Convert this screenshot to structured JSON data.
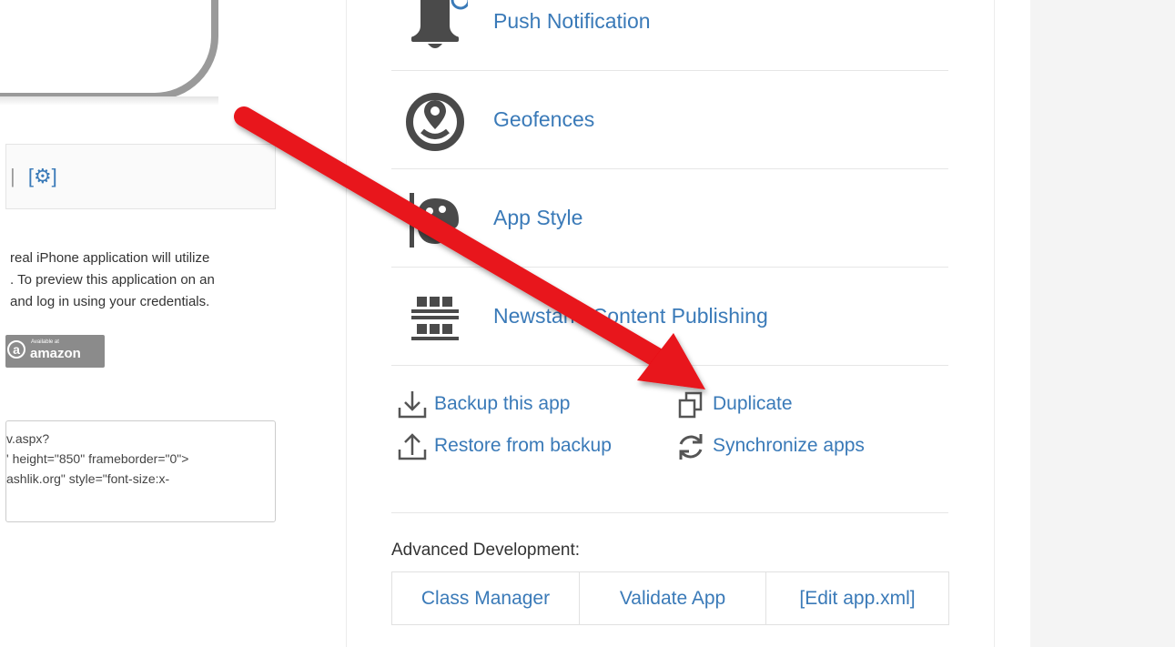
{
  "left_panel": {
    "toolbar_separator": "|",
    "toolbar_settings_label": "[⚙]",
    "description_lines": [
      "real iPhone application will utilize",
      ". To preview this application on an",
      "and log in using your credentials."
    ],
    "amazon_badge": {
      "small_text": "Available at",
      "big_text": "amazon",
      "glyph": "a"
    },
    "embed_code_lines": [
      "v.aspx?",
      "' height=\"850\" frameborder=\"0\">",
      "ashlik.org\" style=\"font-size:x-"
    ]
  },
  "features": [
    {
      "label": "Push Notification",
      "icon": "bell-icon"
    },
    {
      "label": "Geofences",
      "icon": "geofence-icon"
    },
    {
      "label": "App Style",
      "icon": "palette-icon"
    },
    {
      "label": "Newstand Content Publishing",
      "icon": "newsstand-icon"
    }
  ],
  "actions": {
    "backup": {
      "label": "Backup this app",
      "icon": "download-icon"
    },
    "restore": {
      "label": "Restore from backup",
      "icon": "upload-icon"
    },
    "duplicate": {
      "label": "Duplicate",
      "icon": "duplicate-icon"
    },
    "sync": {
      "label": "Synchronize apps",
      "icon": "sync-icon"
    }
  },
  "advanced": {
    "label": "Advanced Development:",
    "buttons": [
      "Class Manager",
      "Validate App",
      "[Edit app.xml]"
    ]
  },
  "colors": {
    "link": "#3a7ab8",
    "icon": "#555555",
    "arrow": "#e8121a"
  }
}
